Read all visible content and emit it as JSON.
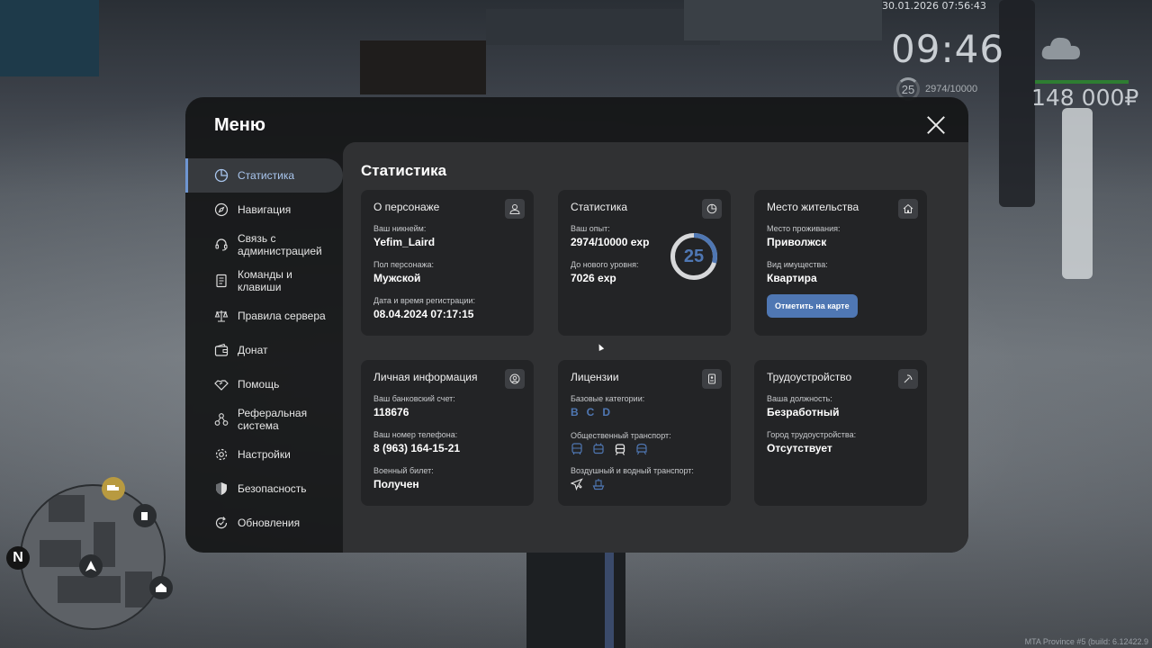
{
  "hud": {
    "date": "30.01.2026 07:56:43",
    "time": "09:46",
    "level": "25",
    "exp": "2974/10000",
    "money": "148 000₽",
    "build": "MTA Province #5 (build: 6.12422.9"
  },
  "minimap": {
    "north": "N"
  },
  "menu": {
    "title": "Меню",
    "sidebar": [
      {
        "label": "Статистика",
        "icon": "pie-chart-icon",
        "active": true
      },
      {
        "label": "Навигация",
        "icon": "compass-icon"
      },
      {
        "label": "Связь с администрацией",
        "icon": "headset-icon"
      },
      {
        "label": "Команды и клавиши",
        "icon": "document-icon"
      },
      {
        "label": "Правила сервера",
        "icon": "scales-icon"
      },
      {
        "label": "Донат",
        "icon": "wallet-icon"
      },
      {
        "label": "Помощь",
        "icon": "handshake-icon"
      },
      {
        "label": "Реферальная система",
        "icon": "referral-icon"
      },
      {
        "label": "Настройки",
        "icon": "gear-icon"
      },
      {
        "label": "Безопасность",
        "icon": "shield-icon"
      },
      {
        "label": "Обновления",
        "icon": "refresh-icon"
      }
    ]
  },
  "stats": {
    "title": "Статистика",
    "character": {
      "title": "О персонаже",
      "nickname_label": "Ваш никнейм:",
      "nickname": "Yefim_Laird",
      "gender_label": "Пол персонажа:",
      "gender": "Мужской",
      "reg_label": "Дата и время регистрации:",
      "reg": "08.04.2024 07:17:15"
    },
    "statistics": {
      "title": "Статистика",
      "exp_label": "Ваш опыт:",
      "exp": "2974/10000 exp",
      "next_label": "До нового уровня:",
      "next": "7026 exp",
      "level": "25",
      "progress": 0.2974,
      "accent": "#4f77b3"
    },
    "residence": {
      "title": "Место жительства",
      "place_label": "Место проживания:",
      "place": "Приволжск",
      "property_label": "Вид имущества:",
      "property": "Квартира",
      "button": "Отметить на карте"
    },
    "personal": {
      "title": "Личная информация",
      "bank_label": "Ваш банковский счет:",
      "bank": "118676",
      "phone_label": "Ваш номер телефона:",
      "phone": "8 (963) 164-15-21",
      "military_label": "Военный билет:",
      "military": "Получен"
    },
    "licenses": {
      "title": "Лицензии",
      "base_label": "Базовые категории:",
      "categories": [
        "B",
        "C",
        "D"
      ],
      "public_label": "Общественный транспорт:",
      "public_icons": [
        "bus-icon",
        "trolleybus-icon",
        "tram-icon",
        "train-icon"
      ],
      "air_label": "Воздушный и водный транспорт:",
      "air_icons": [
        "plane-icon",
        "boat-icon"
      ]
    },
    "employment": {
      "title": "Трудоустройство",
      "position_label": "Ваша должность:",
      "position": "Безработный",
      "city_label": "Город трудоустройства:",
      "city": "Отсутствует"
    }
  }
}
